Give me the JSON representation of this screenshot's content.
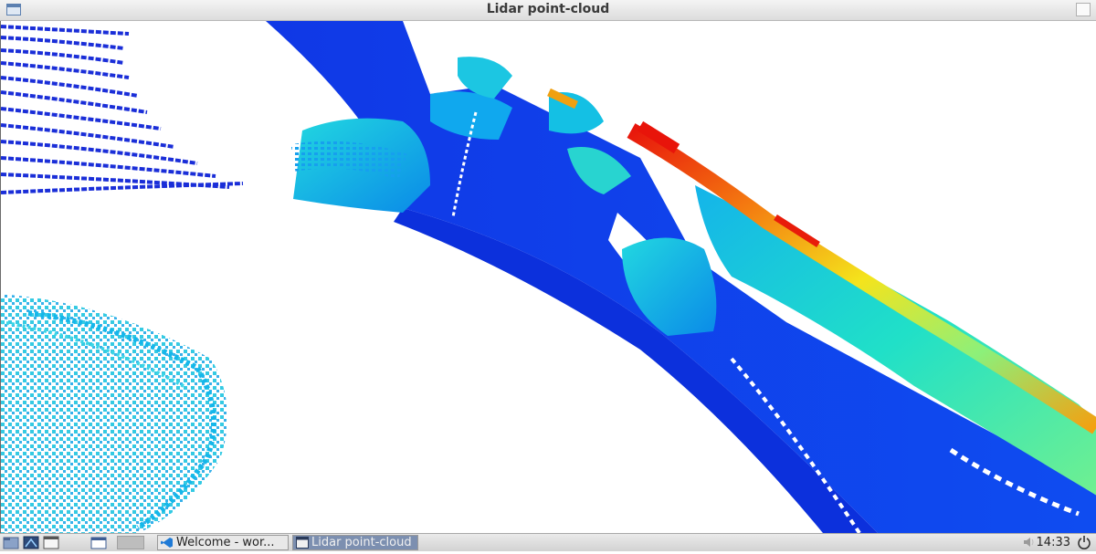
{
  "window": {
    "title": "Lidar point-cloud",
    "menu_icon": "window-menu-icon",
    "close_icon": "window-close-icon"
  },
  "viewport": {
    "content": "lidar point cloud rendered with jet colormap (blue = low/near, red = high)",
    "colors": {
      "background": "#ffffff",
      "low": "#0a20d8",
      "mid": "#19d6d0",
      "mid2": "#f0e81c",
      "high": "#e0140a"
    }
  },
  "taskbar": {
    "launchers": [
      {
        "icon": "file-manager-icon"
      },
      {
        "icon": "network-icon"
      },
      {
        "icon": "window-icon"
      },
      {
        "icon": "show-desktop-icon"
      }
    ],
    "tasks": [
      {
        "label": "Welcome - wor...",
        "icon": "vscode-icon",
        "active": false
      },
      {
        "label": "Lidar point-cloud",
        "icon": "window-icon",
        "active": true
      }
    ],
    "volume_icon": "volume-icon",
    "clock": "14:33",
    "power_icon": "power-icon"
  }
}
